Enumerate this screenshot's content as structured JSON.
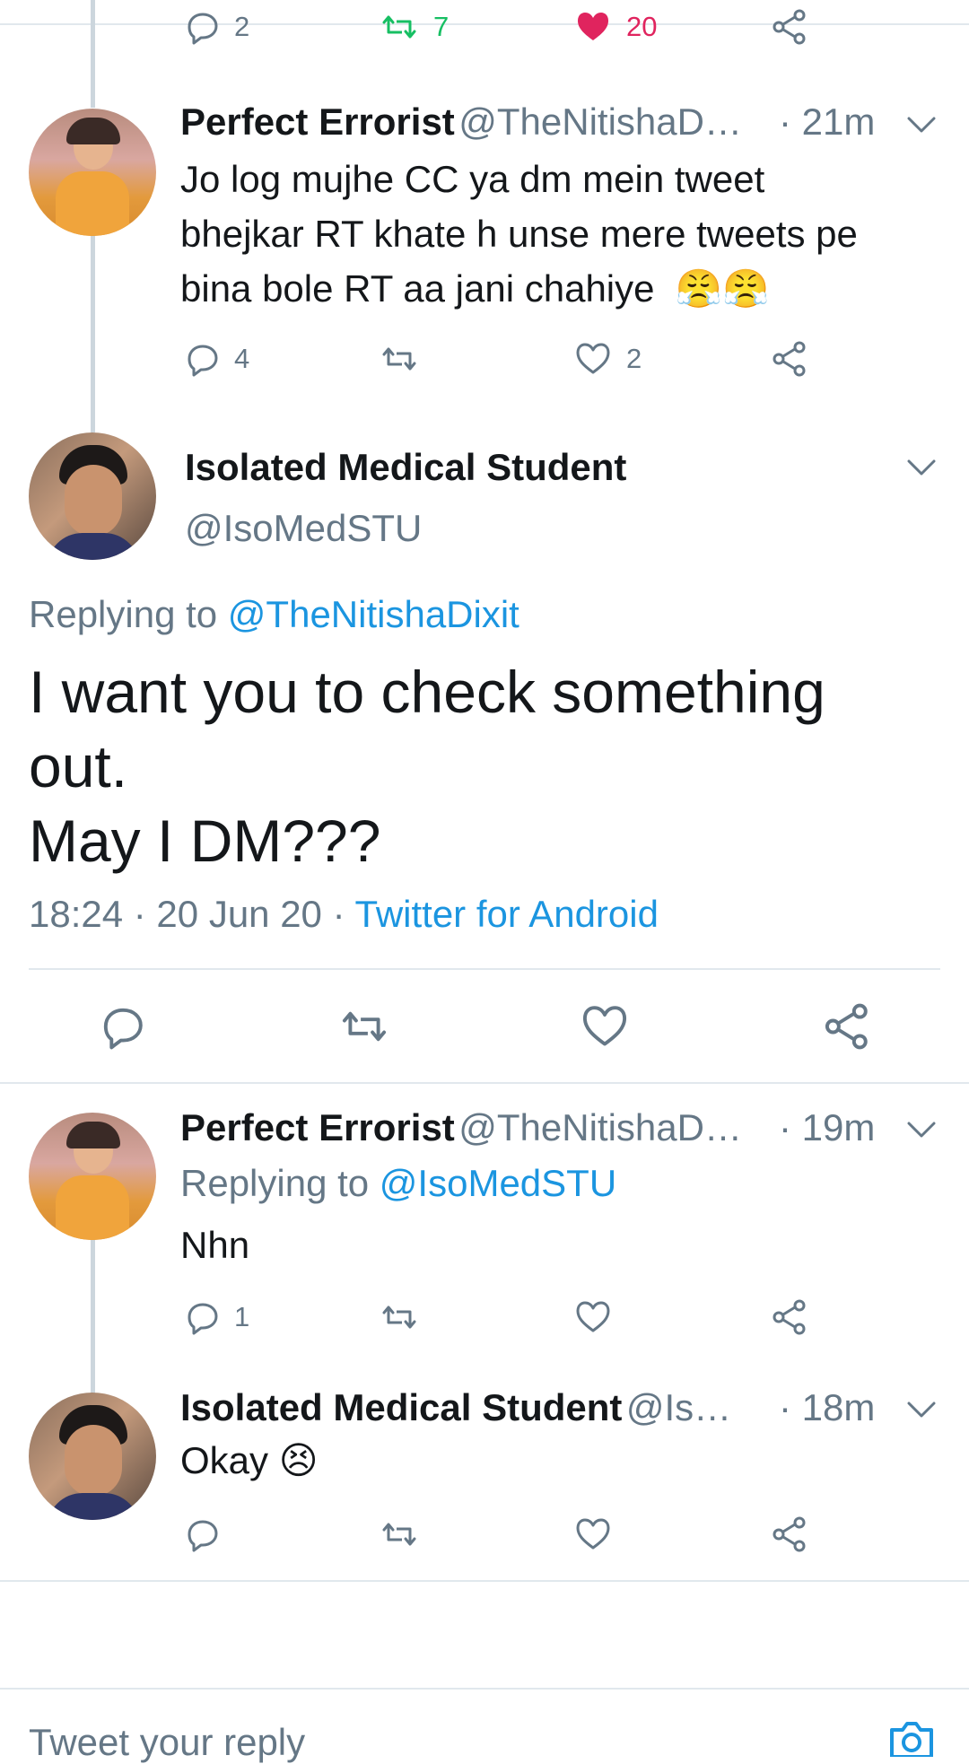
{
  "top_actions": {
    "reply_count": "2",
    "retweet_count": "7",
    "like_count": "20"
  },
  "tweet1": {
    "name": "Perfect Errorist",
    "handle": "@TheNitishaD…",
    "time": "· 21m",
    "text_lines": [
      "Jo log mujhe CC ya dm mein tweet",
      "bhejkar RT khate h unse mere tweets pe",
      "bina bole RT aa jani chahiye"
    ],
    "emoji": "😤😤",
    "reply_count": "4",
    "like_count": "2"
  },
  "main_tweet": {
    "name": "Isolated Medical Student",
    "handle": "@IsoMedSTU",
    "replying_prefix": "Replying to",
    "replying_handle": "@TheNitishaDixit",
    "text_lines": [
      "I want you to check something",
      "out.",
      "May I DM???"
    ],
    "meta_time": "18:24 · 20 Jun 20 · ",
    "meta_source": "Twitter for Android"
  },
  "reply1": {
    "name": "Perfect Errorist",
    "handle": "@TheNitishaD…",
    "time": "· 19m",
    "replying_prefix": "Replying to",
    "replying_handle": "@IsoMedSTU",
    "text": "Nhn",
    "reply_count": "1"
  },
  "reply2": {
    "name": "Isolated Medical Student",
    "handle": "@Is…",
    "time": "· 18m",
    "text": "Okay",
    "emoji": "😣"
  },
  "composer": {
    "placeholder": "Tweet your reply"
  },
  "colors": {
    "retweet_green": "#17bf63",
    "like_red": "#e0245e",
    "link_blue": "#1b95e0",
    "secondary_gray": "#657786"
  }
}
